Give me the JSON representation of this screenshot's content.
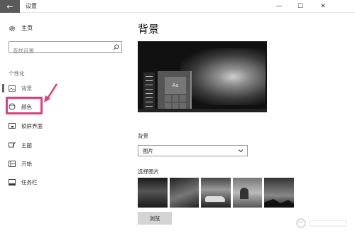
{
  "window": {
    "title": "设置",
    "back_glyph": "←",
    "minimize_glyph": "—",
    "maximize_glyph": "☐",
    "close_glyph": "✕"
  },
  "sidebar": {
    "home_label": "主页",
    "search_placeholder": "查找设置",
    "section_title": "个性化",
    "items": [
      {
        "label": "背景",
        "icon": "picture-icon",
        "selected": true
      },
      {
        "label": "颜色",
        "icon": "palette-icon",
        "selected": false
      },
      {
        "label": "锁屏界面",
        "icon": "lock-screen-icon",
        "selected": false
      },
      {
        "label": "主题",
        "icon": "theme-brush-icon",
        "selected": false
      },
      {
        "label": "开始",
        "icon": "start-grid-icon",
        "selected": false
      },
      {
        "label": "任务栏",
        "icon": "taskbar-icon",
        "selected": false
      }
    ],
    "highlight_color": "#e0407a"
  },
  "main": {
    "page_title": "背景",
    "preview": {
      "tile_text": "Aa"
    },
    "background_label": "背景",
    "background_dropdown_value": "图片",
    "choose_picture_label": "选择图片",
    "thumbnails": [
      "wallpaper-thumbnail-1",
      "wallpaper-thumbnail-2",
      "wallpaper-thumbnail-3",
      "wallpaper-thumbnail-4",
      "wallpaper-thumbnail-5"
    ],
    "browse_button_label": "浏览"
  },
  "colors": {
    "accent": "#e0407a",
    "titlebar_back": "#5a5a5a"
  }
}
